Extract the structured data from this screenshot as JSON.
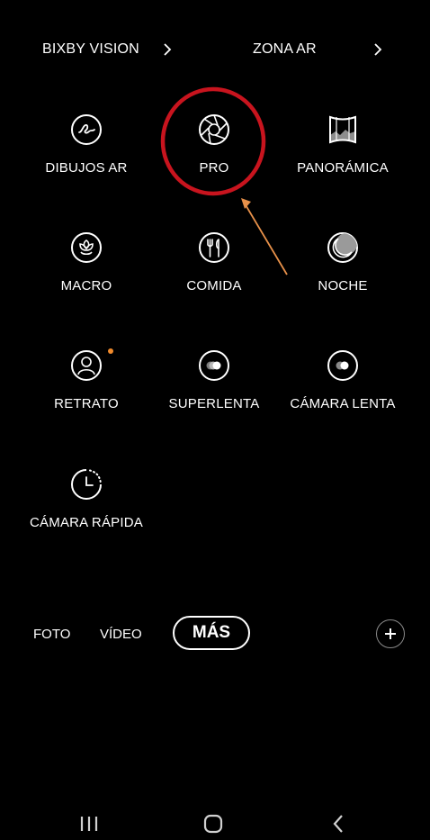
{
  "top_links": {
    "bixby_vision": "BIXBY VISION",
    "zona_ar": "ZONA AR"
  },
  "modes": [
    {
      "label": "DIBUJOS AR",
      "icon": "ar-doodle-icon"
    },
    {
      "label": "PRO",
      "icon": "aperture-icon"
    },
    {
      "label": "PANORÁMICA",
      "icon": "panorama-icon"
    },
    {
      "label": "MACRO",
      "icon": "flower-icon"
    },
    {
      "label": "COMIDA",
      "icon": "fork-knife-icon"
    },
    {
      "label": "NOCHE",
      "icon": "moon-icon"
    },
    {
      "label": "RETRATO",
      "icon": "portrait-icon"
    },
    {
      "label": "SUPERLENTA",
      "icon": "super-slow-mo-icon"
    },
    {
      "label": "CÁMARA LENTA",
      "icon": "slow-motion-icon"
    },
    {
      "label": "CÁMARA RÁPIDA",
      "icon": "hyperlapse-icon"
    }
  ],
  "tabs": {
    "foto": "FOTO",
    "video": "VÍDEO",
    "mas": "MÁS"
  },
  "nav": [
    "recent-apps-icon",
    "home-icon",
    "back-icon"
  ],
  "colors": {
    "background": "#000000",
    "text": "#ffffff",
    "annotation_circle": "#c8141e",
    "annotation_arrow": "#e8914a",
    "notification_dot": "#f08a2c"
  }
}
